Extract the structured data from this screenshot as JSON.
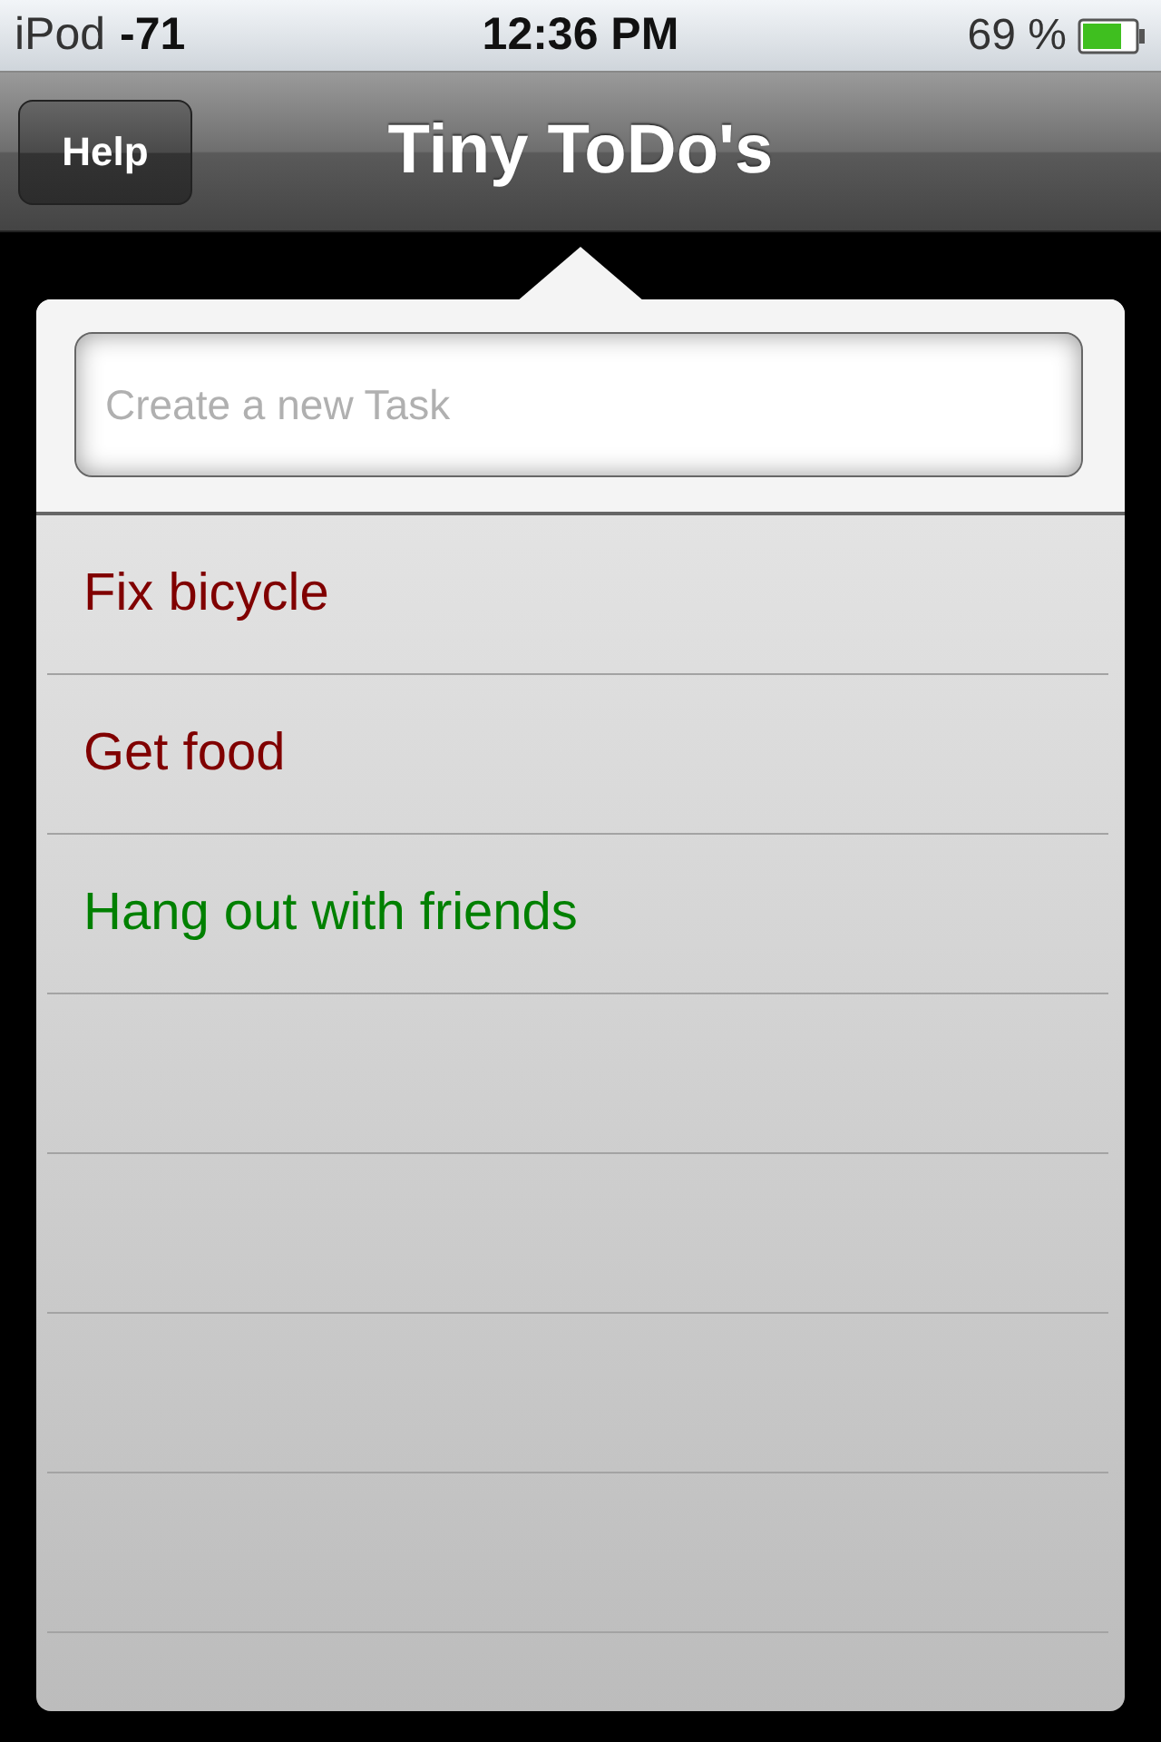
{
  "status_bar": {
    "carrier": "iPod",
    "signal": "-71",
    "time": "12:36 PM",
    "battery": "69 %"
  },
  "nav_bar": {
    "title": "Tiny ToDo's",
    "left_button": "Help"
  },
  "new_task": {
    "placeholder": "Create a new Task"
  },
  "tasks": [
    {
      "label": "Fix bicycle",
      "color": "#800000"
    },
    {
      "label": "Get food",
      "color": "#800000"
    },
    {
      "label": "Hang out with friends",
      "color": "#008000"
    }
  ]
}
